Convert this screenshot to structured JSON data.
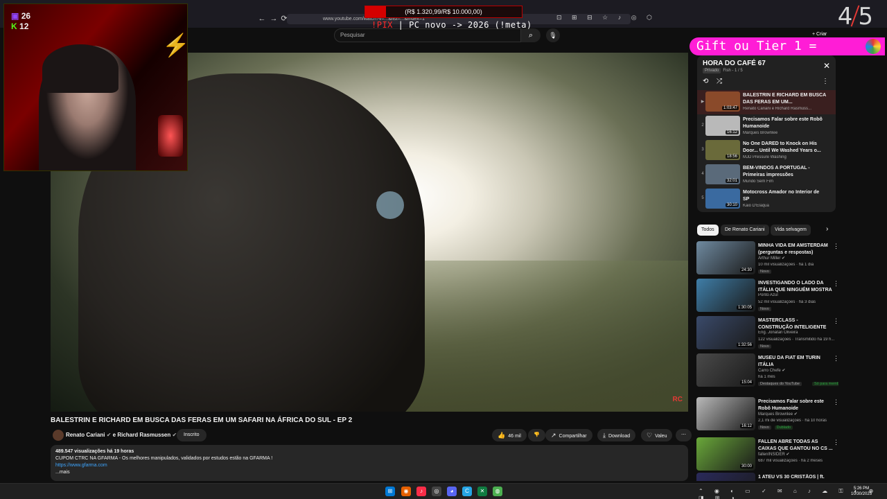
{
  "browser": {
    "url": "www.youtube.com/watch?v=...&list=...&index=1",
    "nav": {
      "back": "←",
      "forward": "→",
      "reload": "⟳"
    },
    "toolbar_icons": "⊡ ⊞ ⊟ ☆ ♪ ◎ ⬡"
  },
  "stream": {
    "donation": {
      "text": "(R$ 1.320,99/R$ 10.000,00)",
      "progress": 0.132
    },
    "pix_prefix": "!PIX",
    "pix_text": " | PC novo -> 2026 (!meta)",
    "counter_left": "4",
    "counter_right": "5",
    "twitch_viewers": "26",
    "kick_viewers": "12",
    "gift_banner": "Gift ou Tier 1 ="
  },
  "youtube": {
    "search_placeholder": "Pesquisar",
    "create_label": "+ Criar",
    "video": {
      "title": "BALESTRIN E RICHARD EM BUSCA DAS FERAS EM UM SAFARI NA ÁFRICA DO SUL - EP 2",
      "channel": "Renato Cariani",
      "collab": "e Richard Rasmussen",
      "subscribed_label": "Inscrito",
      "likes": "46 mil",
      "share_label": "Compartilhar",
      "download_label": "Download",
      "thanks_label": "Valeu",
      "more_label": "⋯",
      "watermark": "RC",
      "description": {
        "meta": "489.547 visualizações  há 19 horas",
        "line1": "CUPOM CTRC NA GFARMA - Os melhores manipulados, validados por estudos estão na GFARMA !",
        "link": "https://www.gfarma.com",
        "more": "...mais"
      }
    },
    "playlist": {
      "title": "HORA DO CAFÉ 67",
      "privacy": "Privado",
      "meta": "Fish - 1 / 5",
      "items": [
        {
          "index": "▶",
          "title": "BALESTRIN E RICHARD EM BUSCA DAS FERAS EM UM...",
          "channel": "Renato Cariani e Richard Rasmuss...",
          "duration": "1:03:47",
          "color": "#8a4a2a"
        },
        {
          "index": "2",
          "title": "Precisamos Falar sobre este Robô Humanoide",
          "channel": "Marques Brownlee",
          "duration": "16:12",
          "color": "#b9b9b9"
        },
        {
          "index": "3",
          "title": "No One DARED to Knock on His Door... Until We Washed Years o...",
          "channel": "MJD Pressure Washing",
          "duration": "18:56",
          "color": "#6a6a3a"
        },
        {
          "index": "4",
          "title": "BEM-VINDOS A PORTUGAL - Primeiras impressões",
          "channel": "Mundo Sem Fim",
          "duration": "32:01",
          "color": "#5a6a7a"
        },
        {
          "index": "5",
          "title": "Motocross Amador no Interior de SP",
          "channel": "Kaio D'Elaqua",
          "duration": "30:10",
          "color": "#3a6aa0"
        }
      ]
    },
    "chips": [
      "Todos",
      "De Renato Cariani",
      "Vida selvagem"
    ],
    "recommendations": [
      {
        "title": "MINHA VIDA EM AMSTERDAM (perguntas e respostas)",
        "channel": "Arthur Miller ✔",
        "stats": "10 mil visualizações · há 1 dia",
        "badge": "Novo",
        "badge_green": "",
        "duration": "24:30",
        "color": "#6f8aa0"
      },
      {
        "title": "INVESTIGANDO O LADO DA ITÁLIA QUE NINGUÉM MOSTRA",
        "channel": "Ponto Azul",
        "stats": "52 mil visualizações · há 3 dias",
        "badge": "Novo",
        "badge_green": "",
        "duration": "1:30:05",
        "color": "#3f7ea8"
      },
      {
        "title": "MASTERCLASS - CONSTRUÇÃO INTELIGENTE",
        "channel": "Eng. Jonatan Oliveira",
        "stats": "122 visualizações · Transmitido há 19 h...",
        "badge": "Novo",
        "badge_green": "",
        "duration": "1:32:56",
        "color": "#3a4a6a"
      },
      {
        "title": "MUSEU DA FIAT EM TURIN ITÁLIA",
        "channel": "Carro Chefe ✔",
        "stats": "há 1 mês",
        "badge": "Destaques do YouTube",
        "badge_green": "Só para membros",
        "duration": "15:04",
        "color": "#4a4a4a"
      },
      {
        "title": "Precisamos Falar sobre este Robô Humanoide",
        "channel": "Marques Brownlee ✔",
        "stats": "2,1 mi de visualizações · há 10 horas",
        "badge": "Novo",
        "badge_green": "Dublado",
        "duration": "16:12",
        "color": "#b9b9b9"
      },
      {
        "title": "FALLEN ABRE TODAS AS CAIXAS QUE GANTOU NO CS ...",
        "channel": "fallenINSIDER ✔",
        "stats": "687 mil visualizações · há 2 meses",
        "badge": "",
        "badge_green": "",
        "duration": "30:00",
        "color": "#6aa83a"
      },
      {
        "title": "1 ATEU VS 30 CRISTÃOS | ft.",
        "channel": "",
        "stats": "",
        "badge": "",
        "badge_green": "",
        "duration": "",
        "color": "#2a2a5a"
      }
    ]
  },
  "taskbar": {
    "clock_time": "5:26 PM",
    "clock_date": "10/30/2025",
    "tray": "⌃ ◉ ◐ ▭ ✓ ✉ ⌂ ♪ ☁ ⚿ ◐ ⊕ ◨ ⊞ ◑"
  }
}
